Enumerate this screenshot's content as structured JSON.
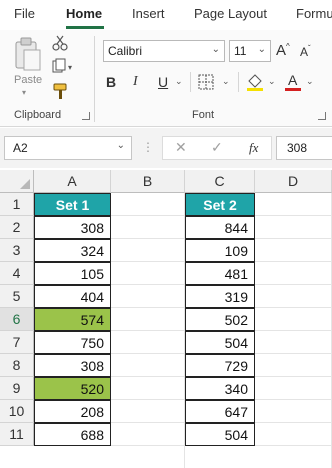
{
  "ribbon_tabs": [
    "File",
    "Home",
    "Insert",
    "Page Layout",
    "Formu"
  ],
  "active_tab": "Home",
  "clipboard": {
    "paste_label": "Paste",
    "group_label": "Clipboard"
  },
  "font": {
    "name": "Calibri",
    "size": "11",
    "group_label": "Font",
    "bold": "B",
    "italic": "I",
    "underline": "U",
    "grow": "A",
    "shrink": "A",
    "color_letter": "A"
  },
  "formula_bar": {
    "name_box": "A2",
    "fx": "fx",
    "value": "308"
  },
  "columns": [
    "A",
    "B",
    "C",
    "D"
  ],
  "rows": [
    "1",
    "2",
    "3",
    "4",
    "5",
    "6",
    "7",
    "8",
    "9",
    "10",
    "11"
  ],
  "selected_row": "6",
  "headers": {
    "set1": "Set 1",
    "set2": "Set 2"
  },
  "set1": [
    "308",
    "324",
    "105",
    "404",
    "574",
    "750",
    "308",
    "520",
    "208",
    "688"
  ],
  "set2": [
    "844",
    "109",
    "481",
    "319",
    "502",
    "504",
    "729",
    "340",
    "647",
    "504"
  ],
  "highlight_color": "#9bc34a",
  "header_color": "#1fa4a8",
  "highlighted_set1_rows": [
    "6",
    "9"
  ]
}
